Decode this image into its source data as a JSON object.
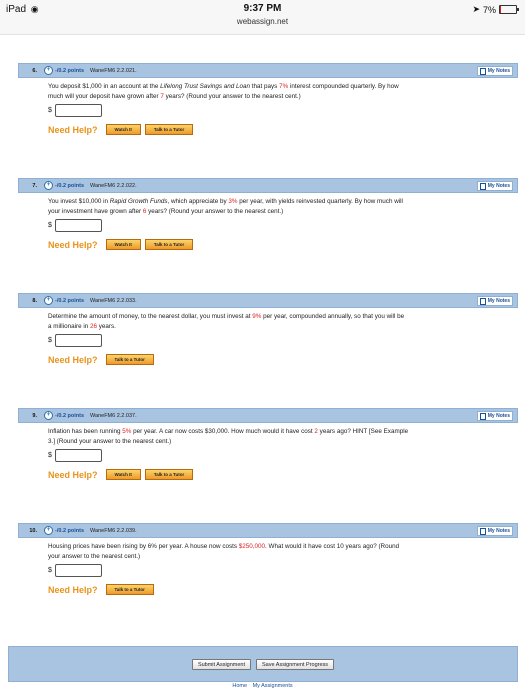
{
  "status_bar": {
    "device": "iPad",
    "time": "9:37 PM",
    "url": "webassign.net",
    "battery": "7%",
    "battery_level": 0.07
  },
  "questions": [
    {
      "number": "6.",
      "points": "-/0.2 points",
      "ref": "WaneFM6 2.2.021.",
      "my_notes": "My Notes",
      "lines": [
        [
          "You deposit $1,000 in an account at the ",
          {
            "i": "Lifelong Trust Savings and Loan"
          },
          " that pays ",
          {
            "r": "7%"
          },
          " interest compounded quarterly. By how"
        ],
        [
          "much will your deposit have grown after ",
          {
            "r": "7"
          },
          " years? (Round your answer to the nearest cent.)"
        ]
      ],
      "dollar": "$",
      "need_help": "Need Help?",
      "buttons": [
        "Watch It",
        "Talk to a Tutor"
      ]
    },
    {
      "number": "7.",
      "points": "-/0.2 points",
      "ref": "WaneFM6 2.2.022.",
      "my_notes": "My Notes",
      "lines": [
        [
          "You invest $10,000 in ",
          {
            "i": "Rapid Growth Funds"
          },
          ", which appreciate by ",
          {
            "r": "3%"
          },
          " per year, with yields reinvested quarterly. By how much will"
        ],
        [
          "your investment have grown after ",
          {
            "r": "6"
          },
          " years? (Round your answer to the nearest cent.)"
        ]
      ],
      "dollar": "$",
      "need_help": "Need Help?",
      "buttons": [
        "Watch It",
        "Talk to a Tutor"
      ]
    },
    {
      "number": "8.",
      "points": "-/0.2 points",
      "ref": "WaneFM6 2.2.033.",
      "my_notes": "My Notes",
      "lines": [
        [
          "Determine the amount of money, to the nearest dollar, you must invest at ",
          {
            "r": "9%"
          },
          " per year, compounded annually, so that you will be"
        ],
        [
          "a millionaire in ",
          {
            "r": "26"
          },
          " years."
        ]
      ],
      "dollar": "$",
      "need_help": "Need Help?",
      "buttons": [
        "Talk to a Tutor"
      ]
    },
    {
      "number": "9.",
      "points": "-/0.2 points",
      "ref": "WaneFM6 2.2.037.",
      "my_notes": "My Notes",
      "lines": [
        [
          "Inflation has been running ",
          {
            "r": "5%"
          },
          " per year. A car now costs $30,000. How much would it have cost ",
          {
            "r": "2"
          },
          " years ago? HINT [See Example"
        ],
        [
          "3.] (Round your answer to the nearest cent.)"
        ]
      ],
      "dollar": "$",
      "need_help": "Need Help?",
      "buttons": [
        "Watch It",
        "Talk to a Tutor"
      ]
    },
    {
      "number": "10.",
      "points": "-/0.2 points",
      "ref": "WaneFM6 2.2.039.",
      "my_notes": "My Notes",
      "lines": [
        [
          "Housing prices have been rising by 6% per year. A house now costs ",
          {
            "r": "$250,000"
          },
          ". What would it have cost 10 years ago? (Round"
        ],
        [
          "your answer to the nearest cent.)"
        ]
      ],
      "dollar": "$",
      "need_help": "Need Help?",
      "buttons": [
        "Talk to a Tutor"
      ]
    }
  ],
  "footer": {
    "buttons": [
      "Submit Assignment",
      "Save Assignment Progress"
    ],
    "links": [
      "Home",
      "My Assignments"
    ]
  },
  "colors": {
    "header_blue": "#a8c4e0",
    "accent_orange": "#e8941a",
    "highlight_red": "#d22222",
    "link_blue": "#1a4f99"
  }
}
